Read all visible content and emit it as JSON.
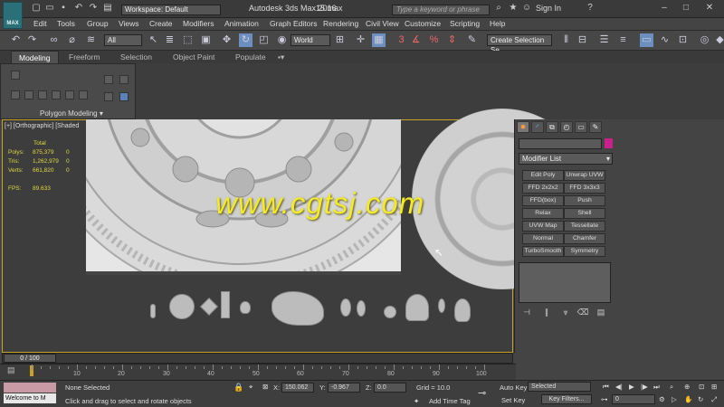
{
  "app": {
    "logo_text": "MAX",
    "workspace": "Workspace: Default",
    "title": "Autodesk 3ds Max 2016",
    "file": "15.max",
    "search_placeholder": "Type a keyword or phrase",
    "sign_in": "Sign In"
  },
  "menu": [
    "Edit",
    "Tools",
    "Group",
    "Views",
    "Create",
    "Modifiers",
    "Animation",
    "Graph Editors",
    "Rendering",
    "Civil View",
    "Customize",
    "Scripting",
    "Help"
  ],
  "toolbar": {
    "filter": "All",
    "coord": "World",
    "selection_set": "Create Selection Se",
    "spinner_value": "3"
  },
  "ribbon": {
    "tabs": [
      "Modeling",
      "Freeform",
      "Selection",
      "Object Paint",
      "Populate"
    ],
    "active_tab": "Modeling",
    "panel_caption": "Polygon Modeling"
  },
  "viewport": {
    "label": "[+] [Orthographic] [Shaded",
    "stats": {
      "total_label": "Total",
      "polys_label": "Polys:",
      "polys_total": "875,379",
      "polys_sel": "0",
      "tris_label": "Tris:",
      "tris_total": "1,262,979",
      "tris_sel": "0",
      "verts_label": "Verts:",
      "verts_total": "661,820",
      "verts_sel": "0",
      "fps_label": "FPS:",
      "fps": "89.633"
    },
    "watermark": "www.cgtsj.com"
  },
  "command_panel": {
    "modifier_list": "Modifier List",
    "modifiers": [
      "Edit Poly",
      "Unwrap UVW",
      "FFD 2x2x2",
      "FFD 3x3x3",
      "FFD(box)",
      "Push",
      "Relax",
      "Shell",
      "UVW Map",
      "Tessellate",
      "Normal",
      "Chamfer",
      "TurboSmooth",
      "Symmetry"
    ]
  },
  "timeline": {
    "slider": "0 / 100",
    "ticks": [
      "10",
      "20",
      "30",
      "40",
      "50",
      "60",
      "70",
      "80",
      "90",
      "100"
    ]
  },
  "status": {
    "maxscript": "Welcome to M",
    "selection": "None Selected",
    "prompt": "Click and drag to select and rotate objects",
    "x_label": "X:",
    "x": "150.062",
    "y_label": "Y:",
    "y": "-0.967",
    "z_label": "Z:",
    "z": "0.0",
    "grid": "Grid = 10.0",
    "add_time_tag": "Add Time Tag",
    "auto_key": "Auto Key",
    "set_key": "Set Key",
    "selected": "Selected",
    "key_filters": "Key Filters...",
    "frame": "0"
  }
}
